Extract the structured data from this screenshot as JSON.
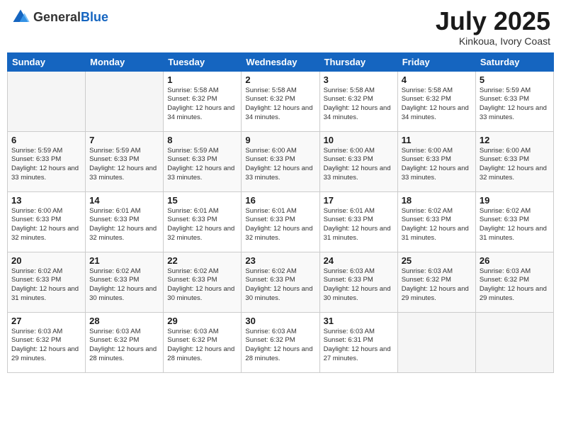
{
  "header": {
    "logo_general": "General",
    "logo_blue": "Blue",
    "month_title": "July 2025",
    "location": "Kinkoua, Ivory Coast"
  },
  "days_of_week": [
    "Sunday",
    "Monday",
    "Tuesday",
    "Wednesday",
    "Thursday",
    "Friday",
    "Saturday"
  ],
  "weeks": [
    [
      {
        "day": "",
        "info": ""
      },
      {
        "day": "",
        "info": ""
      },
      {
        "day": "1",
        "info": "Sunrise: 5:58 AM\nSunset: 6:32 PM\nDaylight: 12 hours and 34 minutes."
      },
      {
        "day": "2",
        "info": "Sunrise: 5:58 AM\nSunset: 6:32 PM\nDaylight: 12 hours and 34 minutes."
      },
      {
        "day": "3",
        "info": "Sunrise: 5:58 AM\nSunset: 6:32 PM\nDaylight: 12 hours and 34 minutes."
      },
      {
        "day": "4",
        "info": "Sunrise: 5:58 AM\nSunset: 6:32 PM\nDaylight: 12 hours and 34 minutes."
      },
      {
        "day": "5",
        "info": "Sunrise: 5:59 AM\nSunset: 6:33 PM\nDaylight: 12 hours and 33 minutes."
      }
    ],
    [
      {
        "day": "6",
        "info": "Sunrise: 5:59 AM\nSunset: 6:33 PM\nDaylight: 12 hours and 33 minutes."
      },
      {
        "day": "7",
        "info": "Sunrise: 5:59 AM\nSunset: 6:33 PM\nDaylight: 12 hours and 33 minutes."
      },
      {
        "day": "8",
        "info": "Sunrise: 5:59 AM\nSunset: 6:33 PM\nDaylight: 12 hours and 33 minutes."
      },
      {
        "day": "9",
        "info": "Sunrise: 6:00 AM\nSunset: 6:33 PM\nDaylight: 12 hours and 33 minutes."
      },
      {
        "day": "10",
        "info": "Sunrise: 6:00 AM\nSunset: 6:33 PM\nDaylight: 12 hours and 33 minutes."
      },
      {
        "day": "11",
        "info": "Sunrise: 6:00 AM\nSunset: 6:33 PM\nDaylight: 12 hours and 33 minutes."
      },
      {
        "day": "12",
        "info": "Sunrise: 6:00 AM\nSunset: 6:33 PM\nDaylight: 12 hours and 32 minutes."
      }
    ],
    [
      {
        "day": "13",
        "info": "Sunrise: 6:00 AM\nSunset: 6:33 PM\nDaylight: 12 hours and 32 minutes."
      },
      {
        "day": "14",
        "info": "Sunrise: 6:01 AM\nSunset: 6:33 PM\nDaylight: 12 hours and 32 minutes."
      },
      {
        "day": "15",
        "info": "Sunrise: 6:01 AM\nSunset: 6:33 PM\nDaylight: 12 hours and 32 minutes."
      },
      {
        "day": "16",
        "info": "Sunrise: 6:01 AM\nSunset: 6:33 PM\nDaylight: 12 hours and 32 minutes."
      },
      {
        "day": "17",
        "info": "Sunrise: 6:01 AM\nSunset: 6:33 PM\nDaylight: 12 hours and 31 minutes."
      },
      {
        "day": "18",
        "info": "Sunrise: 6:02 AM\nSunset: 6:33 PM\nDaylight: 12 hours and 31 minutes."
      },
      {
        "day": "19",
        "info": "Sunrise: 6:02 AM\nSunset: 6:33 PM\nDaylight: 12 hours and 31 minutes."
      }
    ],
    [
      {
        "day": "20",
        "info": "Sunrise: 6:02 AM\nSunset: 6:33 PM\nDaylight: 12 hours and 31 minutes."
      },
      {
        "day": "21",
        "info": "Sunrise: 6:02 AM\nSunset: 6:33 PM\nDaylight: 12 hours and 30 minutes."
      },
      {
        "day": "22",
        "info": "Sunrise: 6:02 AM\nSunset: 6:33 PM\nDaylight: 12 hours and 30 minutes."
      },
      {
        "day": "23",
        "info": "Sunrise: 6:02 AM\nSunset: 6:33 PM\nDaylight: 12 hours and 30 minutes."
      },
      {
        "day": "24",
        "info": "Sunrise: 6:03 AM\nSunset: 6:33 PM\nDaylight: 12 hours and 30 minutes."
      },
      {
        "day": "25",
        "info": "Sunrise: 6:03 AM\nSunset: 6:32 PM\nDaylight: 12 hours and 29 minutes."
      },
      {
        "day": "26",
        "info": "Sunrise: 6:03 AM\nSunset: 6:32 PM\nDaylight: 12 hours and 29 minutes."
      }
    ],
    [
      {
        "day": "27",
        "info": "Sunrise: 6:03 AM\nSunset: 6:32 PM\nDaylight: 12 hours and 29 minutes."
      },
      {
        "day": "28",
        "info": "Sunrise: 6:03 AM\nSunset: 6:32 PM\nDaylight: 12 hours and 28 minutes."
      },
      {
        "day": "29",
        "info": "Sunrise: 6:03 AM\nSunset: 6:32 PM\nDaylight: 12 hours and 28 minutes."
      },
      {
        "day": "30",
        "info": "Sunrise: 6:03 AM\nSunset: 6:32 PM\nDaylight: 12 hours and 28 minutes."
      },
      {
        "day": "31",
        "info": "Sunrise: 6:03 AM\nSunset: 6:31 PM\nDaylight: 12 hours and 27 minutes."
      },
      {
        "day": "",
        "info": ""
      },
      {
        "day": "",
        "info": ""
      }
    ]
  ]
}
